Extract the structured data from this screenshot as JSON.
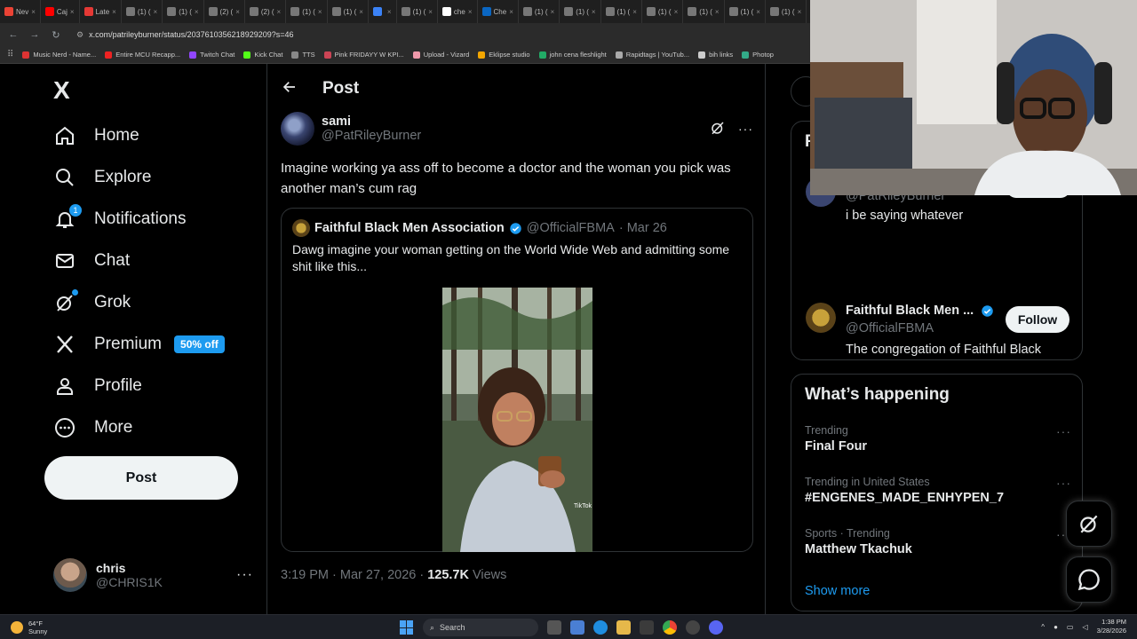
{
  "browser": {
    "tabs": [
      "Nev",
      "Caj",
      "Late",
      "(1) (",
      "(1) (",
      "(2) (",
      "(2) (",
      "(1) (",
      "(1) (",
      "",
      "(1) (",
      "che",
      "Che",
      "(1) (",
      "(1) (",
      "(1) (",
      "(1) (",
      "(1) (",
      "(1) (",
      "(1) (",
      "(1) ("
    ],
    "url": "x.com/patrileyburner/status/2037610356218929209?s=46",
    "bookmarks": [
      "Music Nerd - Name...",
      "Entire MCU Recapp...",
      "Twitch Chat",
      "Kick Chat",
      "TTS",
      "Pink FRIDAYY W KPI...",
      "Upload - Vizard",
      "Eklipse studio",
      "john cena fleshlight",
      "Rapidtags | YouTub...",
      "bih links",
      "Photop"
    ]
  },
  "leftnav": {
    "logo": "X",
    "items": [
      {
        "label": "Home",
        "icon": "home-icon"
      },
      {
        "label": "Explore",
        "icon": "search-icon"
      },
      {
        "label": "Notifications",
        "icon": "bell-icon",
        "badge": "1"
      },
      {
        "label": "Chat",
        "icon": "mail-icon"
      },
      {
        "label": "Grok",
        "icon": "grok-icon"
      },
      {
        "label": "Premium",
        "icon": "x-icon",
        "pill": "50% off"
      },
      {
        "label": "Profile",
        "icon": "person-icon"
      },
      {
        "label": "More",
        "icon": "more-circle-icon"
      }
    ],
    "post_button": "Post",
    "account": {
      "name": "chris",
      "handle": "@CHRIS1K",
      "more": "···"
    }
  },
  "post": {
    "header_title": "Post",
    "author_name": "sami",
    "author_handle": "@PatRileyBurner",
    "text": "Imagine working ya ass off to become a doctor and the woman you pick was another man’s cum rag",
    "quote": {
      "name": "Faithful Black Men Association",
      "handle": "@OfficialFBMA",
      "date": "· Mar 26",
      "text": "Dawg imagine your woman getting on the World Wide Web and admitting some shit like this..."
    },
    "time": "3:19 PM · Mar 27, 2026 ·",
    "views_count": "125.7K",
    "views_label": "Views"
  },
  "right": {
    "who_letter": "F",
    "who1": {
      "handle": "@PatRileyBurner",
      "bio": "i be saying whatever"
    },
    "who2": {
      "name": "Faithful Black Men ...",
      "handle": "@OfficialFBMA",
      "bio": "The congregation of Faithful Black Men. Serving| Protecting| Honoring| “Fidus Achates” || All Business inquiries Info@TheFBMA.org",
      "follow": "Follow"
    },
    "trends_title": "What’s happening",
    "trends": [
      {
        "context": "Trending",
        "name": "Final Four"
      },
      {
        "context": "Trending in United States",
        "name": "#ENGENES_MADE_ENHYPEN_7"
      },
      {
        "context": "Sports · Trending",
        "name": "Matthew Tkachuk"
      }
    ],
    "show_more": "Show more"
  },
  "taskbar": {
    "temp": "64°F",
    "condition": "Sunny",
    "search": "Search",
    "time": "1:38 PM",
    "date": "3/28/2026"
  },
  "colors": {
    "accent": "#1d9bf0",
    "bg": "#000000",
    "border": "#2f3336",
    "muted": "#71767b"
  }
}
